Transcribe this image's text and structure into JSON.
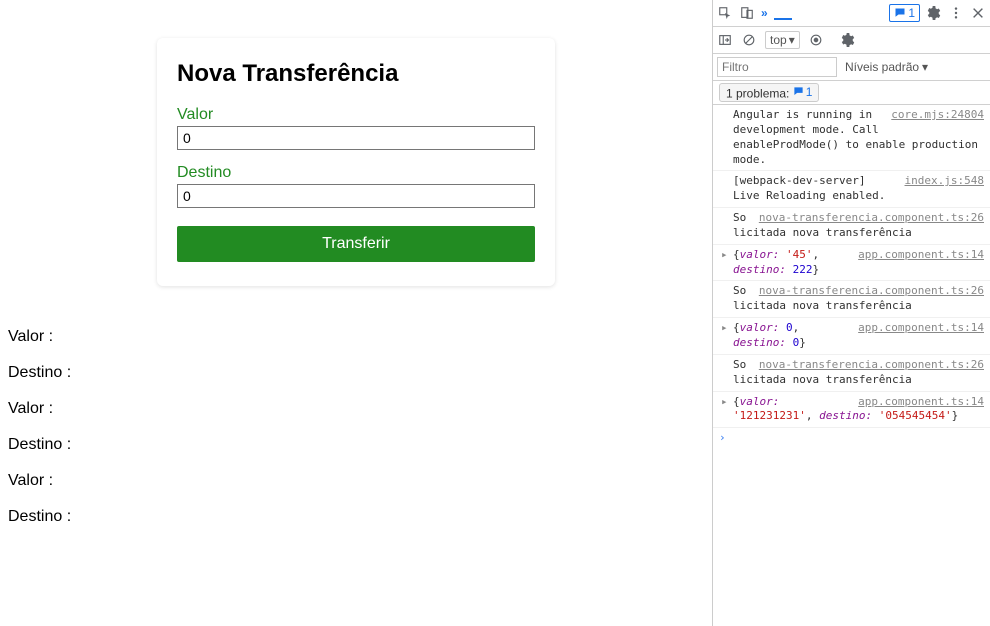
{
  "card": {
    "title": "Nova Transferência",
    "valor_label": "Valor",
    "valor_value": "0",
    "destino_label": "Destino",
    "destino_value": "0",
    "button": "Transferir"
  },
  "history": [
    {
      "valor_label": "Valor :",
      "destino_label": "Destino :"
    },
    {
      "valor_label": "Valor :",
      "destino_label": "Destino :"
    },
    {
      "valor_label": "Valor :",
      "destino_label": "Destino :"
    }
  ],
  "devtools": {
    "msg_count": "1",
    "top_label": "top",
    "filter_placeholder": "Filtro",
    "levels_label": "Níveis padrão",
    "issues_label": "1 problema:",
    "issues_count": "1",
    "logs": [
      {
        "src": "core.mjs:24804",
        "msg": "Angular is running in development mode. Call enableProdMode() to enable production mode.",
        "type": "text"
      },
      {
        "src": "index.js:548",
        "msg": "[webpack-dev-server] Live Reloading enabled.",
        "type": "text"
      },
      {
        "src": "nova-transferencia.component.ts:26",
        "msg": "Solicitada nova transferência",
        "type": "text"
      },
      {
        "src": "app.component.ts:14",
        "type": "obj",
        "pre": "{",
        "k1": "valor:",
        "v1": "'45'",
        "v1t": "s",
        "sep": ", ",
        "k2": "destino:",
        "v2": "222",
        "v2t": "n",
        "post": "}"
      },
      {
        "src": "nova-transferencia.component.ts:26",
        "msg": "Solicitada nova transferência",
        "type": "text"
      },
      {
        "src": "app.component.ts:14",
        "type": "obj",
        "pre": "{",
        "k1": "valor:",
        "v1": "0",
        "v1t": "n",
        "sep": ", ",
        "k2": "destino:",
        "v2": "0",
        "v2t": "n",
        "post": "}"
      },
      {
        "src": "nova-transferencia.component.ts:26",
        "msg": "Solicitada nova transferência",
        "type": "text"
      },
      {
        "src": "app.component.ts:14",
        "type": "obj",
        "pre": "{",
        "k1": "valor:",
        "v1": "'121231231'",
        "v1t": "s",
        "sep": ", ",
        "k2": "destino:",
        "v2": "'054545454'",
        "v2t": "s",
        "post": "}"
      }
    ]
  }
}
